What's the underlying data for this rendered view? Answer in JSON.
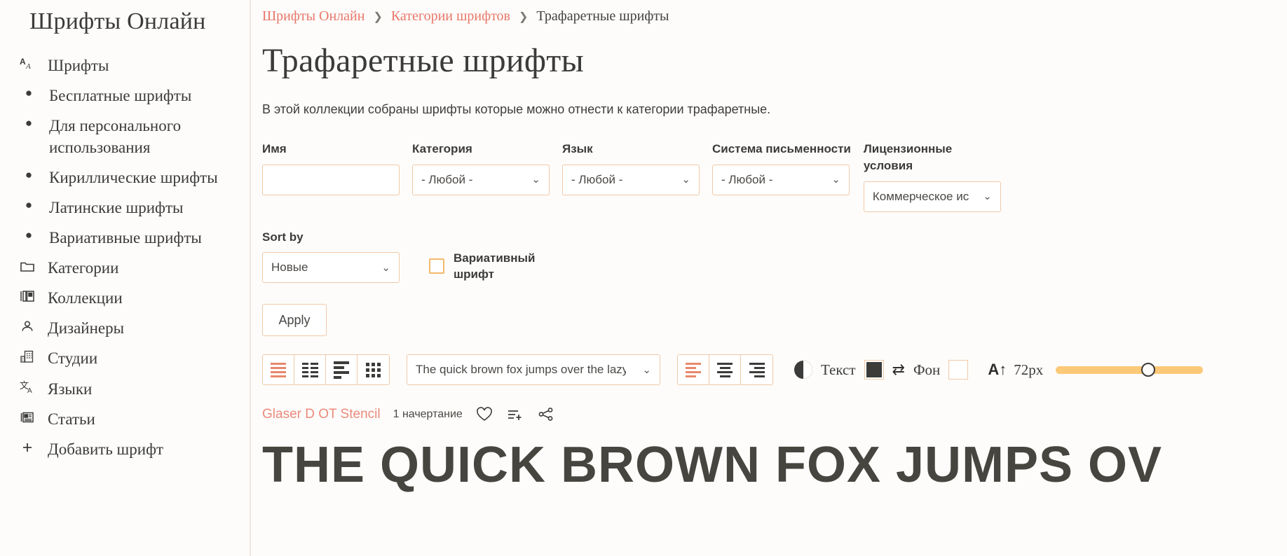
{
  "sidebar": {
    "brand": "Шрифты Онлайн",
    "items": [
      {
        "label": "Шрифты",
        "icon": "font-aa-icon",
        "type": "icon"
      },
      {
        "label": "Бесплатные шрифты",
        "icon": "bullet-icon",
        "type": "bullet"
      },
      {
        "label": "Для персонального использования",
        "icon": "bullet-icon",
        "type": "bullet"
      },
      {
        "label": "Кириллические шрифты",
        "icon": "bullet-icon",
        "type": "bullet"
      },
      {
        "label": "Латинские шрифты",
        "icon": "bullet-icon",
        "type": "bullet"
      },
      {
        "label": "Вариативные шрифты",
        "icon": "bullet-icon",
        "type": "bullet"
      },
      {
        "label": "Категории",
        "icon": "folder-icon",
        "type": "icon"
      },
      {
        "label": "Коллекции",
        "icon": "collections-icon",
        "type": "icon"
      },
      {
        "label": "Дизайнеры",
        "icon": "person-icon",
        "type": "icon"
      },
      {
        "label": "Студии",
        "icon": "building-icon",
        "type": "icon"
      },
      {
        "label": "Языки",
        "icon": "translate-icon",
        "type": "icon"
      },
      {
        "label": "Статьи",
        "icon": "article-icon",
        "type": "icon"
      },
      {
        "label": "Добавить шрифт",
        "icon": "plus-icon",
        "type": "icon"
      }
    ]
  },
  "breadcrumb": {
    "home": "Шрифты Онлайн",
    "sep": "❯",
    "parent": "Категории шрифтов",
    "current": "Трафаретные шрифты"
  },
  "page": {
    "title": "Трафаретные шрифты",
    "description": "В этой коллекции собраны шрифты которые можно отнести к категории трафаретные."
  },
  "filters": {
    "name": {
      "label": "Имя",
      "value": "",
      "placeholder": ""
    },
    "category": {
      "label": "Категория",
      "value": "- Любой -"
    },
    "language": {
      "label": "Язык",
      "value": "- Любой -"
    },
    "script": {
      "label": "Система письменности",
      "value": "- Любой -"
    },
    "license": {
      "label": "Лицензионные условия",
      "value": "Коммерческое ис"
    },
    "sort": {
      "label": "Sort by",
      "value": "Новые"
    },
    "variable": {
      "label": "Вариативный шрифт",
      "checked": false
    },
    "apply": "Apply"
  },
  "toolbar": {
    "views": [
      {
        "name": "list-view-icon",
        "active": true
      },
      {
        "name": "grid-list-view-icon",
        "active": false
      },
      {
        "name": "compact-view-icon",
        "active": false
      },
      {
        "name": "tile-view-icon",
        "active": false
      }
    ],
    "preview_text": "The quick brown fox jumps over the lazy dog",
    "aligns": [
      {
        "name": "align-left-icon",
        "active": true
      },
      {
        "name": "align-center-icon",
        "active": false
      },
      {
        "name": "align-right-icon",
        "active": false
      }
    ],
    "contrast_icon": "contrast-icon",
    "text_label": "Текст",
    "text_color": "#3b3b39",
    "swap_icon": "swap-colors-icon",
    "bg_label": "Фон",
    "bg_color": "#ffffff",
    "size_icon": "font-size-icon",
    "size_label": "72px",
    "accent": "#fcc978"
  },
  "font_item": {
    "name": "Glaser D OT Stencil",
    "styles": "1 начертание",
    "favorite_icon": "heart-icon",
    "addlist_icon": "add-to-list-icon",
    "share_icon": "share-icon",
    "preview": "THE QUICK BROWN FOX JUMPS OV"
  }
}
